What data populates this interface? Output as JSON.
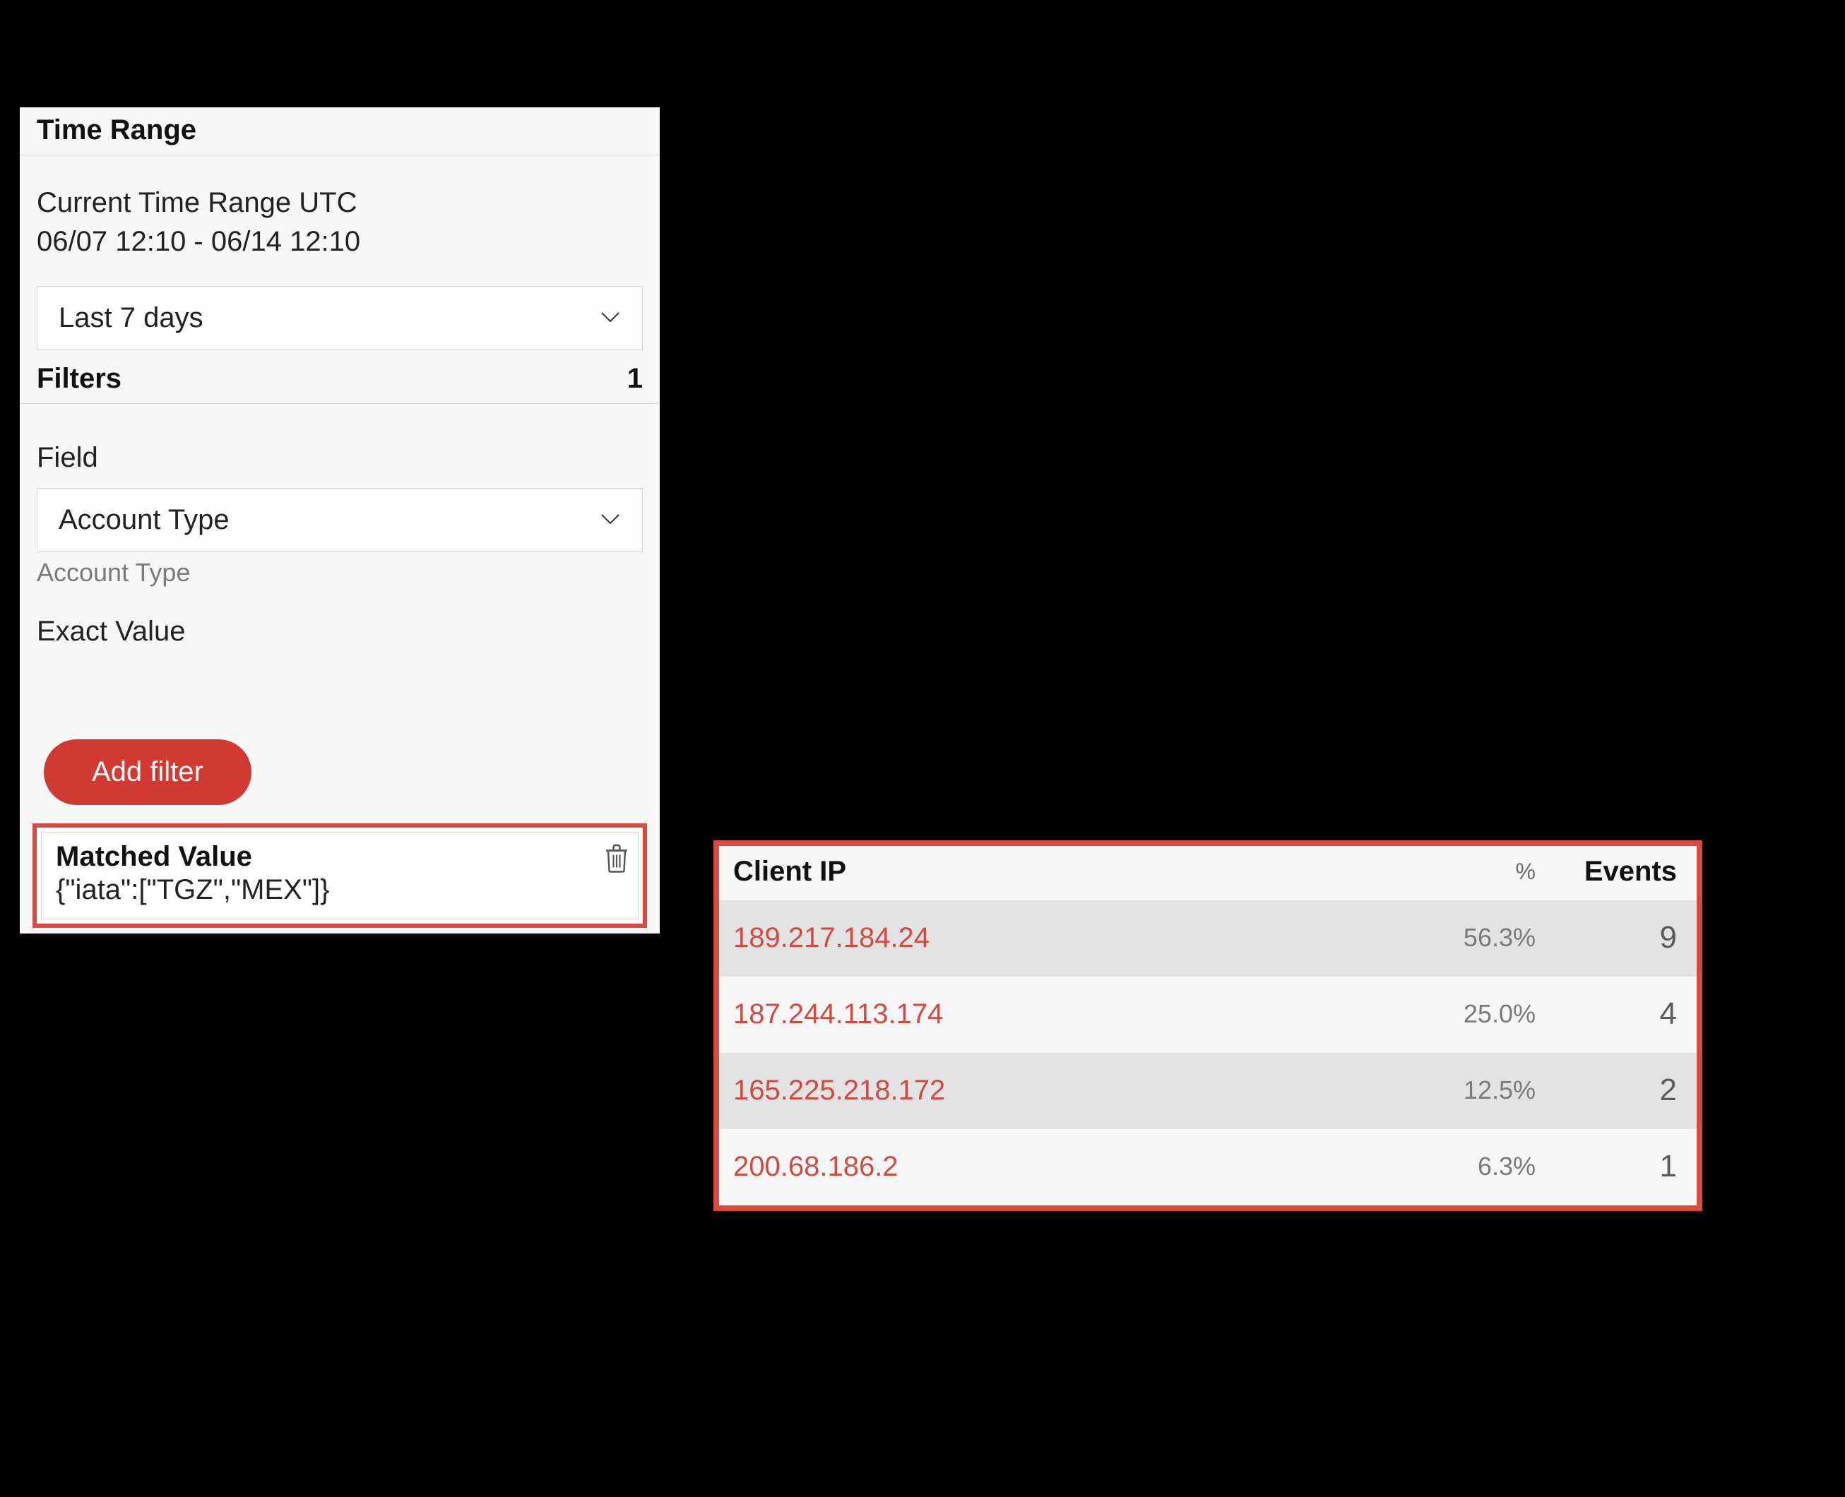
{
  "time_range": {
    "section_title": "Time Range",
    "current_label": "Current Time Range UTC",
    "current_value": "06/07 12:10 - 06/14 12:10",
    "preset_selected": "Last 7 days"
  },
  "filters": {
    "section_title": "Filters",
    "count": "1",
    "field_label": "Field",
    "field_selected": "Account Type",
    "field_subtext": "Account Type",
    "exact_value_label": "Exact Value",
    "add_filter_label": "Add filter",
    "matched": {
      "title": "Matched Value",
      "value": "{\"iata\":[\"TGZ\",\"MEX\"]}"
    }
  },
  "ip_table": {
    "header": {
      "client_ip": "Client IP",
      "percent": "%",
      "events": "Events"
    },
    "rows": [
      {
        "ip": "189.217.184.24",
        "percent": "56.3%",
        "events": "9"
      },
      {
        "ip": "187.244.113.174",
        "percent": "25.0%",
        "events": "4"
      },
      {
        "ip": "165.225.218.172",
        "percent": "12.5%",
        "events": "2"
      },
      {
        "ip": "200.68.186.2",
        "percent": "6.3%",
        "events": "1"
      }
    ]
  },
  "colors": {
    "accent_red": "#d13a33",
    "highlight_red_border": "#da4a3f",
    "ip_text": "#d04b41"
  }
}
